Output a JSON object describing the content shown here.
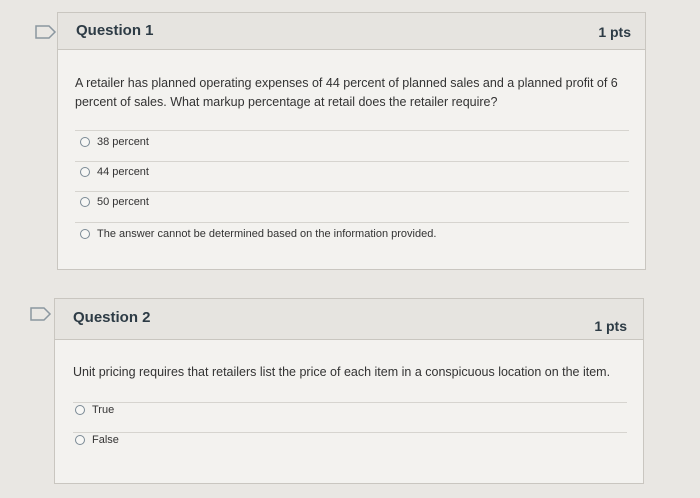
{
  "questions": [
    {
      "title": "Question 1",
      "points": "1 pts",
      "text": "A retailer has planned operating expenses of 44 percent of planned sales and a planned profit of 6 percent of sales. What markup percentage at retail does the retailer require?",
      "options": [
        "38 percent",
        "44 percent",
        "50 percent",
        "The answer cannot be determined based on the information provided."
      ]
    },
    {
      "title": "Question 2",
      "points": "1 pts",
      "text": "Unit pricing requires that retailers list the price of each item in a conspicuous location on the item.",
      "options": [
        "True",
        "False"
      ]
    }
  ],
  "flag_icon": "flag-icon",
  "colors": {
    "flag_border": "#8b97a0",
    "background": "#e9e7e3",
    "card": "#f3f2ef"
  }
}
